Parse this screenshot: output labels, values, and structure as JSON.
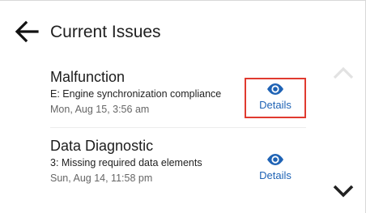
{
  "header": {
    "title": "Current Issues",
    "back_icon": "arrow-left-icon"
  },
  "issues": [
    {
      "name": "Malfunction",
      "description": "E: Engine synchronization compliance",
      "date": "Mon, Aug 15, 3:56 am",
      "details_label": "Details",
      "details_icon": "eye-icon",
      "highlighted": true
    },
    {
      "name": "Data Diagnostic",
      "description": "3: Missing required data elements",
      "date": "Sun, Aug 14, 11:58 pm",
      "details_label": "Details",
      "details_icon": "eye-icon",
      "highlighted": false
    }
  ],
  "colors": {
    "link": "#1f63b5",
    "highlight": "#e03a2f",
    "scroll_up_disabled": "#e2e2e2",
    "scroll_down": "#222222"
  }
}
